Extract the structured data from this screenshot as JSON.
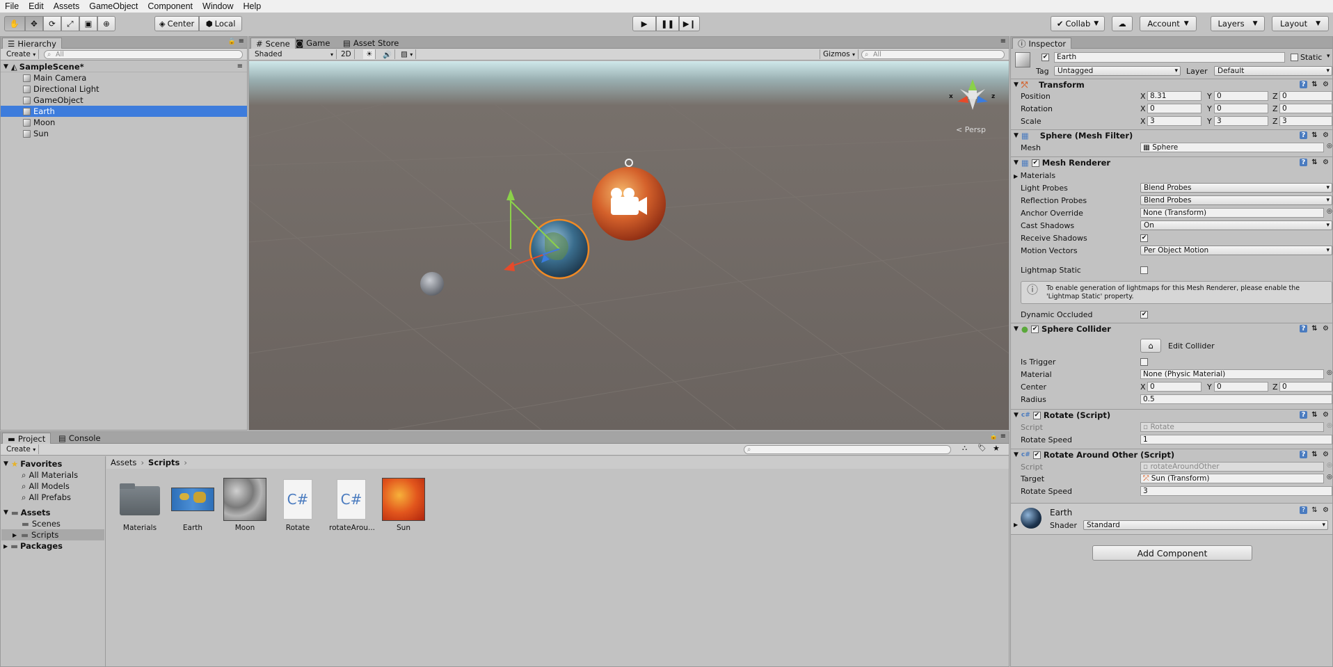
{
  "menu": [
    "File",
    "Edit",
    "Assets",
    "GameObject",
    "Component",
    "Window",
    "Help"
  ],
  "toolbar": {
    "pivot_label": "Center",
    "space_label": "Local",
    "collab_label": "Collab",
    "account_label": "Account",
    "layers_label": "Layers",
    "layout_label": "Layout"
  },
  "hierarchy": {
    "tab_label": "Hierarchy",
    "create_label": "Create",
    "search_placeholder": "All",
    "scene_name": "SampleScene*",
    "items": [
      "Main Camera",
      "Directional Light",
      "GameObject",
      "Earth",
      "Moon",
      "Sun"
    ],
    "selected": "Earth"
  },
  "scene": {
    "tabs": [
      "Scene",
      "Game",
      "Asset Store"
    ],
    "shading_label": "Shaded",
    "mode_2d": "2D",
    "gizmos_label": "Gizmos",
    "search_placeholder": "All",
    "persp_label": "Persp",
    "axis_x": "x",
    "axis_z": "z"
  },
  "inspector": {
    "tab_label": "Inspector",
    "object_name": "Earth",
    "static_label": "Static",
    "tag_label": "Tag",
    "tag_value": "Untagged",
    "layer_label": "Layer",
    "layer_value": "Default",
    "transform": {
      "title": "Transform",
      "position_label": "Position",
      "rotation_label": "Rotation",
      "scale_label": "Scale",
      "position": {
        "x": "8.31",
        "y": "0",
        "z": "0"
      },
      "rotation": {
        "x": "0",
        "y": "0",
        "z": "0"
      },
      "scale": {
        "x": "3",
        "y": "3",
        "z": "3"
      }
    },
    "mesh_filter": {
      "title": "Sphere (Mesh Filter)",
      "mesh_label": "Mesh",
      "mesh_value": "Sphere"
    },
    "mesh_renderer": {
      "title": "Mesh Renderer",
      "materials_label": "Materials",
      "light_probes_label": "Light Probes",
      "light_probes_value": "Blend Probes",
      "reflection_probes_label": "Reflection Probes",
      "reflection_probes_value": "Blend Probes",
      "anchor_override_label": "Anchor Override",
      "anchor_override_value": "None (Transform)",
      "cast_shadows_label": "Cast Shadows",
      "cast_shadows_value": "On",
      "receive_shadows_label": "Receive Shadows",
      "motion_vectors_label": "Motion Vectors",
      "motion_vectors_value": "Per Object Motion",
      "lightmap_static_label": "Lightmap Static",
      "info_text": "To enable generation of lightmaps for this Mesh Renderer, please enable the 'Lightmap Static' property.",
      "dynamic_occluded_label": "Dynamic Occluded"
    },
    "sphere_collider": {
      "title": "Sphere Collider",
      "edit_collider_label": "Edit Collider",
      "is_trigger_label": "Is Trigger",
      "material_label": "Material",
      "material_value": "None (Physic Material)",
      "center_label": "Center",
      "center": {
        "x": "0",
        "y": "0",
        "z": "0"
      },
      "radius_label": "Radius",
      "radius_value": "0.5"
    },
    "rotate_script": {
      "title": "Rotate (Script)",
      "script_label": "Script",
      "script_value": "Rotate",
      "speed_label": "Rotate Speed",
      "speed_value": "1"
    },
    "rotate_around": {
      "title": "Rotate Around Other (Script)",
      "script_label": "Script",
      "script_value": "rotateAroundOther",
      "target_label": "Target",
      "target_value": "Sun (Transform)",
      "speed_label": "Rotate Speed",
      "speed_value": "3"
    },
    "material": {
      "name": "Earth",
      "shader_label": "Shader",
      "shader_value": "Standard"
    },
    "add_component_label": "Add Component"
  },
  "project": {
    "tabs": [
      "Project",
      "Console"
    ],
    "create_label": "Create",
    "favorites_label": "Favorites",
    "favorites": [
      "All Materials",
      "All Models",
      "All Prefabs"
    ],
    "assets_label": "Assets",
    "asset_folders": [
      "Scenes",
      "Scripts"
    ],
    "packages_label": "Packages",
    "breadcrumb": [
      "Assets",
      "Scripts"
    ],
    "files": [
      "Materials",
      "Earth",
      "Moon",
      "Rotate",
      "rotateArou...",
      "Sun"
    ],
    "cs_glyph": "C#"
  },
  "colors": {
    "selection": "#3d7cdc",
    "panel": "#c2c2c2"
  }
}
